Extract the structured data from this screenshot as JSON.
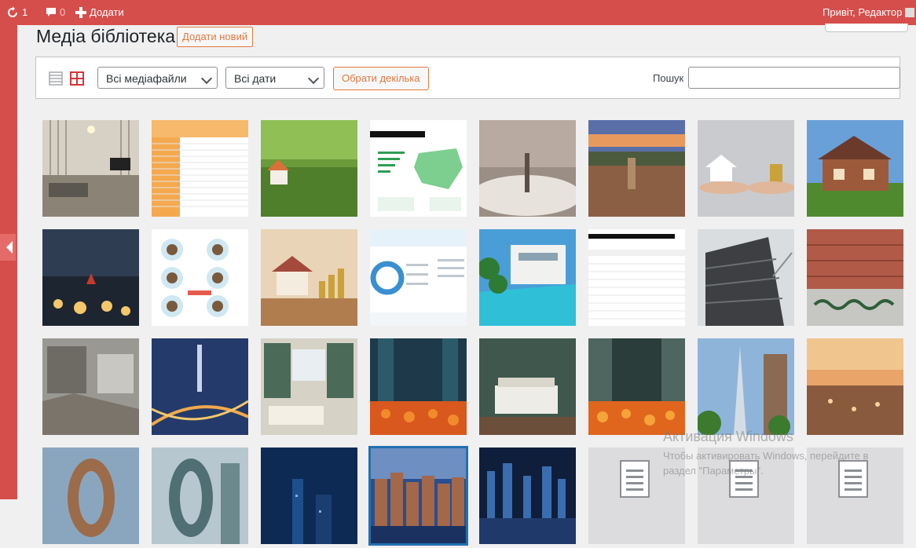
{
  "admin_bar": {
    "updates_count": "1",
    "comments_count": "0",
    "add_label": "Додати",
    "greeting": "Привіт, Редактор"
  },
  "page": {
    "title": "Медіа бібліотека",
    "add_new_label": "Додати новий"
  },
  "toolbar": {
    "media_filter": "Всі медіафайли",
    "date_filter": "Всі дати",
    "bulk_select_label": "Обрати декілька",
    "search_label": "Пошук",
    "search_placeholder": ""
  },
  "grid_tiles": [
    "interior-room",
    "table-chart",
    "grass-house",
    "ukraine-map-infographic",
    "fog-statue",
    "city-panorama",
    "house-coins-hands",
    "wooden-house",
    "atrium-christmas",
    "portrait-infographic",
    "house-coins-bokeh",
    "donut-chart-infographic",
    "pool-villa",
    "prime-cities-table",
    "construction-building",
    "red-building-graffiti",
    "ruins",
    "dubai-night",
    "library-room",
    "city-tulips-night",
    "bedroom",
    "city-tulips",
    "skyscrapers-trees",
    "city-sunset-aerial",
    "oval-building",
    "glass-building",
    "blue-night-city",
    "amsterdam-night",
    "night-skyline",
    "document",
    "document",
    "document"
  ],
  "watermark": {
    "title": "Активация Windows",
    "text": "Чтобы активировать Windows, перейдите в раздел \"Параметры\"."
  },
  "colors": {
    "admin_bar": "#d54e4b",
    "accent": "#e1793f",
    "selected_outline": "#2271b1"
  }
}
